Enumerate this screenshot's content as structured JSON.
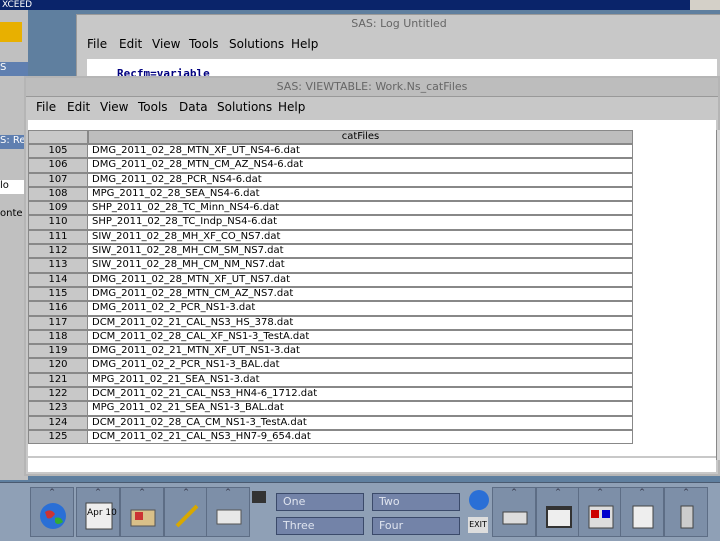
{
  "desktop": {
    "top_strip_text": "XCEED",
    "left_labels": [
      "S",
      "S: Re",
      "lo",
      "onte"
    ]
  },
  "log_window": {
    "title": "SAS: Log Untitled",
    "menu": [
      "File",
      "Edit",
      "View",
      "Tools",
      "Solutions",
      "Help"
    ],
    "code_line": "Recfm=variable"
  },
  "viewtable_window": {
    "title": "SAS: VIEWTABLE: Work.Ns_catFiles",
    "menu": [
      "File",
      "Edit",
      "View",
      "Tools",
      "Data",
      "Solutions",
      "Help"
    ],
    "column_header": "catFiles",
    "rows": [
      {
        "n": "105",
        "v": "DMG_2011_02_28_MTN_XF_UT_NS4-6.dat"
      },
      {
        "n": "106",
        "v": "DMG_2011_02_28_MTN_CM_AZ_NS4-6.dat"
      },
      {
        "n": "107",
        "v": "DMG_2011_02_28_PCR_NS4-6.dat"
      },
      {
        "n": "108",
        "v": "MPG_2011_02_28_SEA_NS4-6.dat"
      },
      {
        "n": "109",
        "v": "SHP_2011_02_28_TC_Minn_NS4-6.dat"
      },
      {
        "n": "110",
        "v": "SHP_2011_02_28_TC_Indp_NS4-6.dat"
      },
      {
        "n": "111",
        "v": "SIW_2011_02_28_MH_XF_CO_NS7.dat"
      },
      {
        "n": "112",
        "v": "SIW_2011_02_28_MH_CM_SM_NS7.dat"
      },
      {
        "n": "113",
        "v": "SIW_2011_02_28_MH_CM_NM_NS7.dat"
      },
      {
        "n": "114",
        "v": "DMG_2011_02_28_MTN_XF_UT_NS7.dat"
      },
      {
        "n": "115",
        "v": "DMG_2011_02_28_MTN_CM_AZ_NS7.dat"
      },
      {
        "n": "116",
        "v": "DMG_2011_02_2_PCR_NS1-3.dat"
      },
      {
        "n": "117",
        "v": "DCM_2011_02_21_CAL_NS3_HS_378.dat"
      },
      {
        "n": "118",
        "v": "DCM_2011_02_28_CAL_XF_NS1-3_TestA.dat"
      },
      {
        "n": "119",
        "v": "DMG_2011_02_21_MTN_XF_UT_NS1-3.dat"
      },
      {
        "n": "120",
        "v": "DMG_2011_02_2_PCR_NS1-3_BAL.dat"
      },
      {
        "n": "121",
        "v": "MPG_2011_02_21_SEA_NS1-3.dat"
      },
      {
        "n": "122",
        "v": "DCM_2011_02_21_CAL_NS3_HN4-6_1712.dat"
      },
      {
        "n": "123",
        "v": "MPG_2011_02_21_SEA_NS1-3_BAL.dat"
      },
      {
        "n": "124",
        "v": "DCM_2011_02_28_CA_CM_NS1-3_TestA.dat"
      },
      {
        "n": "125",
        "v": "DCM_2011_02_21_CAL_NS3_HN7-9_654.dat"
      }
    ]
  },
  "taskbar": {
    "workspaces": [
      "One",
      "Two",
      "Three",
      "Four"
    ],
    "clock_label": "Apr 10",
    "exit_label": "EXIT"
  }
}
